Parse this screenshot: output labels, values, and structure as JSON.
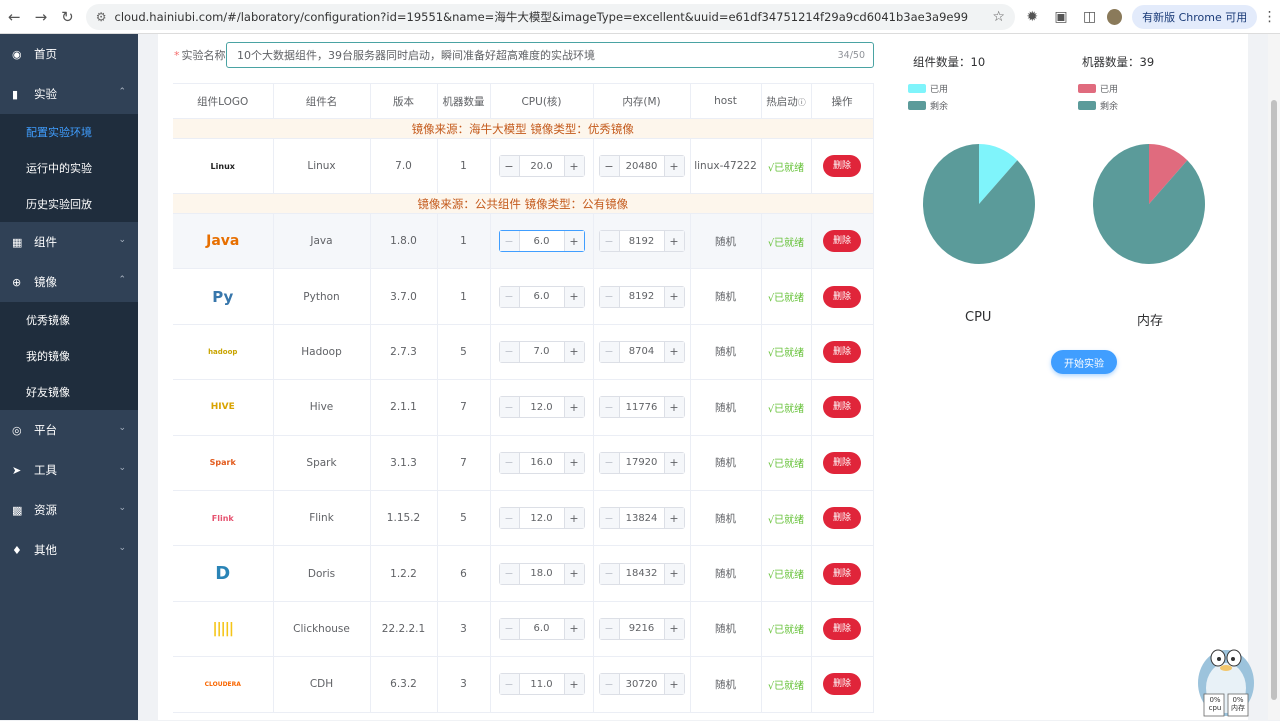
{
  "browser": {
    "url": "cloud.hainiubi.com/#/laboratory/configuration?id=19551&name=海牛大模型&imageType=excellent&uuid=e61df34751214f29a9cd6041b3ae3a9e99",
    "update_label": "有新版 Chrome 可用"
  },
  "sidebar": {
    "home": "首页",
    "experiment": "实验",
    "experiment_sub": [
      "配置实验环境",
      "运行中的实验",
      "历史实验回放"
    ],
    "component": "组件",
    "image": "镜像",
    "image_sub": [
      "优秀镜像",
      "我的镜像",
      "好友镜像"
    ],
    "platform": "平台",
    "tools": "工具",
    "resources": "资源",
    "other": "其他"
  },
  "form": {
    "name_label": "实验名称",
    "name_value": "10个大数据组件，39台服务器同时启动，瞬间准备好超高难度的实战环境",
    "name_count": "34/50"
  },
  "table": {
    "headers": [
      "组件LOGO",
      "组件名",
      "版本",
      "机器数量",
      "CPU(核)",
      "内存(M)",
      "host",
      "热启动",
      "操作"
    ],
    "section1": "镜像来源：海牛大模型    镜像类型：优秀镜像",
    "section2": "镜像来源：公共组件    镜像类型：公有镜像",
    "status_label": "√已就绪",
    "delete_label": "删除",
    "rows": [
      {
        "logo": "Linux",
        "name": "Linux",
        "version": "7.0",
        "machines": "1",
        "cpu": "20.0",
        "mem": "20480",
        "host": "linux-47222"
      },
      {
        "logo": "Java",
        "name": "Java",
        "version": "1.8.0",
        "machines": "1",
        "cpu": "6.0",
        "mem": "8192",
        "host": "随机"
      },
      {
        "logo": "Py",
        "name": "Python",
        "version": "3.7.0",
        "machines": "1",
        "cpu": "6.0",
        "mem": "8192",
        "host": "随机"
      },
      {
        "logo": "hadoop",
        "name": "Hadoop",
        "version": "2.7.3",
        "machines": "5",
        "cpu": "7.0",
        "mem": "8704",
        "host": "随机"
      },
      {
        "logo": "HIVE",
        "name": "Hive",
        "version": "2.1.1",
        "machines": "7",
        "cpu": "12.0",
        "mem": "11776",
        "host": "随机"
      },
      {
        "logo": "Spark",
        "name": "Spark",
        "version": "3.1.3",
        "machines": "7",
        "cpu": "16.0",
        "mem": "17920",
        "host": "随机"
      },
      {
        "logo": "Flink",
        "name": "Flink",
        "version": "1.15.2",
        "machines": "5",
        "cpu": "12.0",
        "mem": "13824",
        "host": "随机"
      },
      {
        "logo": "D",
        "name": "Doris",
        "version": "1.2.2",
        "machines": "6",
        "cpu": "18.0",
        "mem": "18432",
        "host": "随机"
      },
      {
        "logo": "|||||",
        "name": "Clickhouse",
        "version": "22.2.2.1",
        "machines": "3",
        "cpu": "6.0",
        "mem": "9216",
        "host": "随机"
      },
      {
        "logo": "CLOUDERA",
        "name": "CDH",
        "version": "6.3.2",
        "machines": "3",
        "cpu": "11.0",
        "mem": "30720",
        "host": "随机"
      }
    ]
  },
  "stats": {
    "component_label": "组件数量：10",
    "machine_label": "机器数量：39",
    "used_label": "已用",
    "free_label": "剩余",
    "cpu_title": "CPU",
    "mem_title": "内存",
    "start_label": "开始实验"
  },
  "colors": {
    "cpu_used": "#7ff4fb",
    "mem_used": "#e06b7e",
    "free": "#5b9b9a",
    "accent": "#409eff",
    "sidebar": "#304156"
  },
  "chart_data": [
    {
      "type": "pie",
      "title": "CPU",
      "labels": [
        "已用",
        "剩余"
      ],
      "values": [
        0.12,
        0.88
      ]
    },
    {
      "type": "pie",
      "title": "内存",
      "labels": [
        "已用",
        "剩余"
      ],
      "values": [
        0.12,
        0.88
      ]
    }
  ],
  "mascot": {
    "cpu": "0%\ncpu",
    "mem": "0%\n内存"
  }
}
